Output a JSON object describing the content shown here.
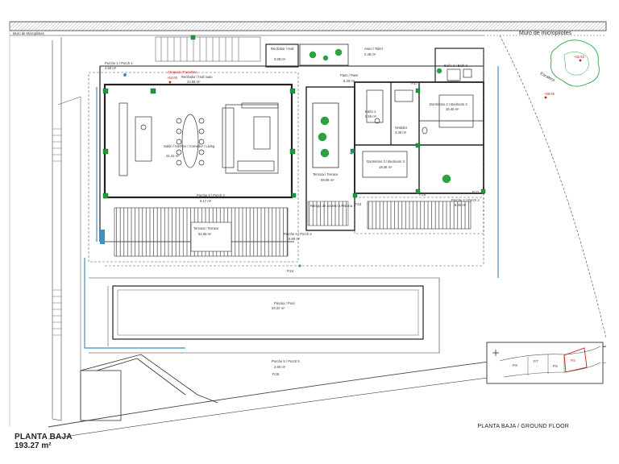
{
  "drawing": {
    "floor_title": "PLANTA BAJA",
    "floor_area": "193.27 m²",
    "floor_caption": "PLANTA BAJA / GROUND FLOOR",
    "wall_label_left": "Muro de Micropilotes",
    "wall_label_right": "Muro de micropilotes",
    "stair_label": "Escalera",
    "level_marks": [
      "+64.00",
      "+62.93",
      "+59.85"
    ]
  },
  "rooms": {
    "porch1": {
      "name": "Porche 1 / Porch 1",
      "area": "4.50 m²"
    },
    "lobby": {
      "name": "Recibidor / Hall",
      "area": "3.08 m²"
    },
    "hall_label": "Chapado Travertino",
    "hall": {
      "name": "Recibidor / Hall main",
      "area": "22.58 m²"
    },
    "living": {
      "name": "Salón / Kitchen / Comedor / Living",
      "area": "41.41 m²"
    },
    "wc": {
      "name": "Aseo / Toilet",
      "area": "2.48 m²"
    },
    "corridor": {
      "name": "Paso / Pass",
      "area": "5.20 m²"
    },
    "bath2": {
      "name": "Baño 2 / Bath 2",
      "area": "3.84 m²"
    },
    "bath1": {
      "name": "Baño 1",
      "area": "5.55 m²"
    },
    "dressing": {
      "name": "Vestidor",
      "area": "4.30 m²"
    },
    "bedroom2": {
      "name": "Dormitorio 2 / Bedroom 2",
      "area": "15.40 m²"
    },
    "bedroom3": {
      "name": "Dormitorio 3 / Bedroom 3",
      "area": "18.36 m²"
    },
    "terrace_inner": {
      "name": "Terraza / Terrace",
      "area": "09.06 m²"
    },
    "porch2": {
      "name": "Porche 2 / Porch 2",
      "area": "8.60 m²"
    },
    "porch3": {
      "name": "Porche 3 / Porch 3",
      "area": "9.17 m²"
    },
    "terrace_main": {
      "name": "Terraza / Terrace",
      "area": "52.58 m²"
    },
    "porch4": {
      "name": "Porche 4 / Porch 4",
      "area": "6.60 m²"
    },
    "porch5": {
      "name": "Porche 5 / Porch 5",
      "area": "2.60 m²"
    },
    "pool": {
      "name": "Piscina / Pool",
      "area": "34.22 m²"
    },
    "pool_note": "Rampa de acceso a Piscina"
  },
  "pillars": [
    "P.17",
    "P.22",
    "P.23",
    "P.24",
    "P.25",
    "P.26"
  ],
  "keymap": {
    "plots": [
      "P.8",
      "P.7",
      "P.6",
      "P.5"
    ],
    "highlight": "P.5",
    "north_symbol": "+"
  },
  "colors": {
    "line": "#333333",
    "dashed": "#555555",
    "level_red": "#d11a1a",
    "column_green": "#1f9a3a",
    "pool_blue": "#3f8fc0",
    "tree_green": "#2aa43c"
  }
}
